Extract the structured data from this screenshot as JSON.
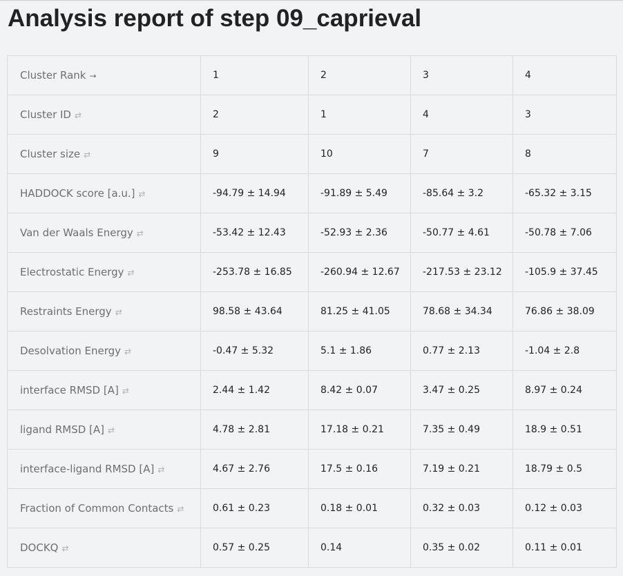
{
  "page": {
    "title": "Analysis report of step 09_caprieval"
  },
  "table": {
    "rows": [
      {
        "label": "Cluster Rank",
        "sort_icon": "→",
        "sort_active": true,
        "values": [
          "1",
          "2",
          "3",
          "4"
        ]
      },
      {
        "label": "Cluster ID",
        "sort_icon": "⇄",
        "sort_active": false,
        "values": [
          "2",
          "1",
          "4",
          "3"
        ]
      },
      {
        "label": "Cluster size",
        "sort_icon": "⇄",
        "sort_active": false,
        "values": [
          "9",
          "10",
          "7",
          "8"
        ]
      },
      {
        "label": "HADDOCK score [a.u.]",
        "sort_icon": "⇄",
        "sort_active": false,
        "values": [
          "-94.79 ± 14.94",
          "-91.89 ± 5.49",
          "-85.64 ± 3.2",
          "-65.32 ± 3.15"
        ]
      },
      {
        "label": "Van der Waals Energy",
        "sort_icon": "⇄",
        "sort_active": false,
        "values": [
          "-53.42 ± 12.43",
          "-52.93 ± 2.36",
          "-50.77 ± 4.61",
          "-50.78 ± 7.06"
        ]
      },
      {
        "label": "Electrostatic Energy",
        "sort_icon": "⇄",
        "sort_active": false,
        "values": [
          "-253.78 ± 16.85",
          "-260.94 ± 12.67",
          "-217.53 ± 23.12",
          "-105.9 ± 37.45"
        ]
      },
      {
        "label": "Restraints Energy",
        "sort_icon": "⇄",
        "sort_active": false,
        "values": [
          "98.58 ± 43.64",
          "81.25 ± 41.05",
          "78.68 ± 34.34",
          "76.86 ± 38.09"
        ]
      },
      {
        "label": "Desolvation Energy",
        "sort_icon": "⇄",
        "sort_active": false,
        "values": [
          "-0.47 ± 5.32",
          "5.1 ± 1.86",
          "0.77 ± 2.13",
          "-1.04 ± 2.8"
        ]
      },
      {
        "label": "interface RMSD [A]",
        "sort_icon": "⇄",
        "sort_active": false,
        "values": [
          "2.44 ± 1.42",
          "8.42 ± 0.07",
          "3.47 ± 0.25",
          "8.97 ± 0.24"
        ]
      },
      {
        "label": "ligand RMSD [A]",
        "sort_icon": "⇄",
        "sort_active": false,
        "values": [
          "4.78 ± 2.81",
          "17.18 ± 0.21",
          "7.35 ± 0.49",
          "18.9 ± 0.51"
        ]
      },
      {
        "label": "interface-ligand RMSD [A]",
        "sort_icon": "⇄",
        "sort_active": false,
        "values": [
          "4.67 ± 2.76",
          "17.5 ± 0.16",
          "7.19 ± 0.21",
          "18.79 ± 0.5"
        ]
      },
      {
        "label": "Fraction of Common Contacts",
        "sort_icon": "⇄",
        "sort_active": false,
        "values": [
          "0.61 ± 0.23",
          "0.18 ± 0.01",
          "0.32 ± 0.03",
          "0.12 ± 0.03"
        ]
      },
      {
        "label": "DOCKQ",
        "sort_icon": "⇄",
        "sort_active": false,
        "values": [
          "0.57 ± 0.25",
          "0.14",
          "0.35 ± 0.02",
          "0.11 ± 0.01"
        ]
      }
    ]
  }
}
